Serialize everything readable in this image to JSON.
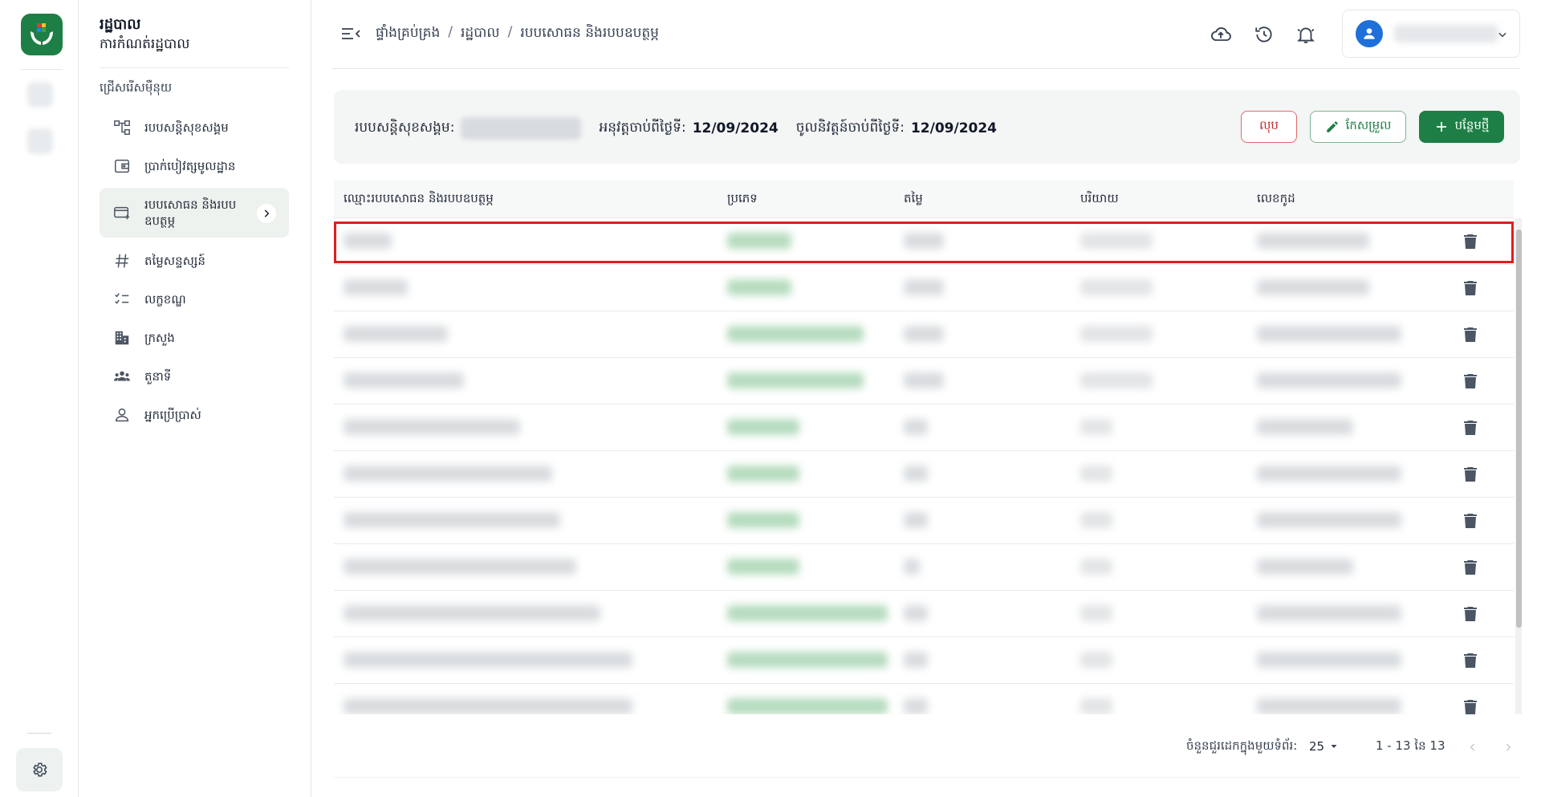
{
  "app": {
    "title": "រដ្ឋបាល",
    "subtitle": "ការកំណត់រដ្ឋបាល"
  },
  "sidebar": {
    "section_label": "ជ្រើសរើសម៉ឺនុយ",
    "items": [
      {
        "label": "របបសន្តិសុខសង្គម",
        "icon": "hierarchy-icon"
      },
      {
        "label": "ប្រាក់បៀវត្សមូលដ្ឋាន",
        "icon": "wallet-icon"
      },
      {
        "label": "របបសោធន និងរបបឧបត្ថម្ភ",
        "icon": "card-add-icon",
        "active": true
      },
      {
        "label": "តម្លៃសន្ទស្សន៍",
        "icon": "hash-icon"
      },
      {
        "label": "លក្ខខណ្ឌ",
        "icon": "checklist-icon"
      },
      {
        "label": "ក្រសួង",
        "icon": "building-icon"
      },
      {
        "label": "តួនាទី",
        "icon": "group-icon"
      },
      {
        "label": "អ្នកប្រើប្រាស់",
        "icon": "person-icon"
      }
    ]
  },
  "header": {
    "breadcrumb": [
      "ផ្ទាំងគ្រប់គ្រង",
      "រដ្ឋបាល",
      "របបសោធន និងរបបឧបត្ថម្ភ"
    ],
    "separator": "/",
    "icons": [
      "cloud-upload-icon",
      "history-icon",
      "bell-icon"
    ]
  },
  "info": {
    "scheme_label": "របបសន្តិសុខសង្គម:",
    "effective_label": "អនុវត្តចាប់ពីថ្ងៃទី:",
    "effective_date": "12/09/2024",
    "valid_label": "ចូលនិវត្តន៍ចាប់ពីថ្ងៃទី:",
    "valid_date": "12/09/2024"
  },
  "actions": {
    "delete_label": "លុប",
    "edit_label": "កែសម្រួល",
    "add_label": "បន្ថែមថ្មី"
  },
  "table": {
    "columns": [
      "ឈ្មោះរបបសោធន និងរបបឧបត្ថម្ភ",
      "ប្រភេទ",
      "តម្លៃ",
      "បរិយាយ",
      "លេខកូដ"
    ],
    "row_count": 11
  },
  "pagination": {
    "rows_per_page_label": "ចំនួនជួរដេកក្នុងមួយទំព័រ:",
    "rows_per_page": "25",
    "range": "1 - 13 នៃ 13"
  },
  "colors": {
    "brand": "#1d7f45",
    "danger": "#c62828",
    "highlight": "#e11d1d"
  }
}
